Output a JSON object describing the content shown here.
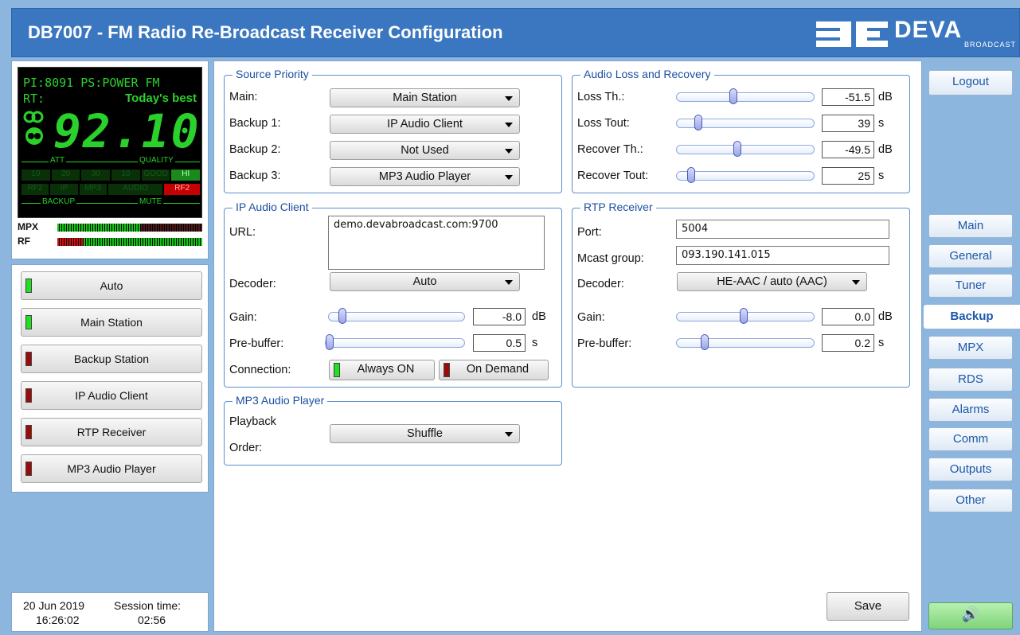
{
  "header": {
    "title": "DB7007 - FM Radio Re-Broadcast Receiver Configuration",
    "logo_text": "DEVA",
    "logo_sub": "BROADCAST"
  },
  "display": {
    "pi_label": "PI:",
    "pi_value": "8091",
    "ps_label": "PS:",
    "ps_value": "POWER FM",
    "rt_label": "RT:",
    "rt_value": "Today's best",
    "frequency": "92.10",
    "att_label": "ATT",
    "quality_label": "QUALITY",
    "att_cells": [
      "10",
      "20",
      "30"
    ],
    "quality_cells": [
      "10",
      "GOOD",
      "HI"
    ],
    "backup_cells": [
      "RF2",
      "IP",
      "MP3"
    ],
    "mute_cells": [
      "AUDIO",
      "RF2"
    ],
    "backup_label": "BACKUP",
    "mute_label": "MUTE",
    "mpx_label": "MPX",
    "rf_label": "RF"
  },
  "sources": [
    {
      "label": "Auto",
      "led": "green"
    },
    {
      "label": "Main Station",
      "led": "green"
    },
    {
      "label": "Backup Station",
      "led": "red"
    },
    {
      "label": "IP Audio Client",
      "led": "red"
    },
    {
      "label": "RTP Receiver",
      "led": "red"
    },
    {
      "label": "MP3 Audio Player",
      "led": "red"
    }
  ],
  "status": {
    "date": "20 Jun 2019",
    "time": "16:26:02",
    "session_label": "Session time:",
    "session_value": "02:56"
  },
  "source_priority": {
    "legend": "Source Priority",
    "rows": [
      {
        "label": "Main:",
        "value": "Main Station"
      },
      {
        "label": "Backup 1:",
        "value": "IP Audio Client"
      },
      {
        "label": "Backup 2:",
        "value": "Not Used"
      },
      {
        "label": "Backup 3:",
        "value": "MP3 Audio Player"
      }
    ]
  },
  "ip_audio": {
    "legend": "IP Audio Client",
    "url_label": "URL:",
    "url_value": "demo.devabroadcast.com:9700",
    "decoder_label": "Decoder:",
    "decoder_value": "Auto",
    "gain_label": "Gain:",
    "gain_value": "-8.0",
    "gain_unit": "dB",
    "prebuffer_label": "Pre-buffer:",
    "prebuffer_value": "0.5",
    "prebuffer_unit": "s",
    "connection_label": "Connection:",
    "always_on": "Always ON",
    "on_demand": "On Demand"
  },
  "mp3": {
    "legend": "MP3 Audio Player",
    "order_label_1": "Playback",
    "order_label_2": "Order:",
    "order_value": "Shuffle"
  },
  "audio_loss": {
    "legend": "Audio Loss and Recovery",
    "rows": [
      {
        "label": "Loss Th.:",
        "value": "-51.5",
        "unit": "dB",
        "level": 0.42
      },
      {
        "label": "Loss Tout:",
        "value": "39",
        "unit": "s",
        "level": 0.15
      },
      {
        "label": "Recover Th.:",
        "value": "-49.5",
        "unit": "dB",
        "level": 0.44
      },
      {
        "label": "Recover Tout:",
        "value": "25",
        "unit": "s",
        "level": 0.09
      }
    ]
  },
  "rtp": {
    "legend": "RTP Receiver",
    "port_label": "Port:",
    "port_value": "5004",
    "mcast_label": "Mcast group:",
    "mcast_value": "093.190.141.015",
    "decoder_label": "Decoder:",
    "decoder_value": "HE-AAC / auto (AAC)",
    "gain_label": "Gain:",
    "gain_value": "0.0",
    "gain_unit": "dB",
    "prebuffer_label": "Pre-buffer:",
    "prebuffer_value": "0.2",
    "prebuffer_unit": "s"
  },
  "save_label": "Save",
  "nav": {
    "logout": "Logout",
    "items": [
      "Main",
      "General",
      "Tuner",
      "Backup",
      "MPX",
      "RDS",
      "Alarms",
      "Comm",
      "Outputs",
      "Other"
    ],
    "active": "Backup"
  },
  "colors": {
    "header": "#3a77c0",
    "background": "#8db6de",
    "lcd_green": "#2bd12b",
    "legend": "#1b4fa0",
    "nav_text": "#1d57a8"
  }
}
